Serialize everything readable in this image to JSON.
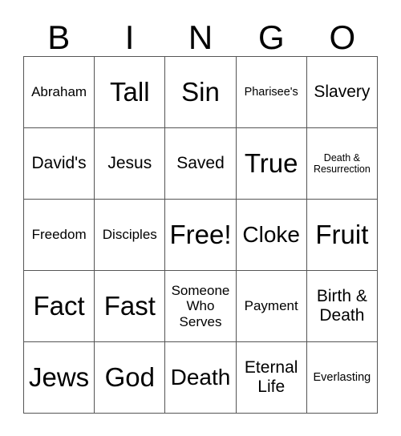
{
  "card": {
    "title": "BINGO",
    "header_letters": [
      "B",
      "I",
      "N",
      "G",
      "O"
    ],
    "columns": 5,
    "rows": 5,
    "border_color": "#555555",
    "text_color": "#000000",
    "background_color": "#ffffff",
    "cells": [
      {
        "row": 1,
        "col": 1,
        "column_letter": "B",
        "text": "Abraham",
        "size": "sm"
      },
      {
        "row": 1,
        "col": 2,
        "column_letter": "I",
        "text": "Tall",
        "size": "xl"
      },
      {
        "row": 1,
        "col": 3,
        "column_letter": "N",
        "text": "Sin",
        "size": "xl"
      },
      {
        "row": 1,
        "col": 4,
        "column_letter": "G",
        "text": "Pharisee's",
        "size": "xs"
      },
      {
        "row": 1,
        "col": 5,
        "column_letter": "O",
        "text": "Slavery",
        "size": "md"
      },
      {
        "row": 2,
        "col": 1,
        "column_letter": "B",
        "text": "David's",
        "size": "md"
      },
      {
        "row": 2,
        "col": 2,
        "column_letter": "I",
        "text": "Jesus",
        "size": "md"
      },
      {
        "row": 2,
        "col": 3,
        "column_letter": "N",
        "text": "Saved",
        "size": "md"
      },
      {
        "row": 2,
        "col": 4,
        "column_letter": "G",
        "text": "True",
        "size": "xl"
      },
      {
        "row": 2,
        "col": 5,
        "column_letter": "O",
        "text": "Death &\nResurrection",
        "size": "xxs"
      },
      {
        "row": 3,
        "col": 1,
        "column_letter": "B",
        "text": "Freedom",
        "size": "sm"
      },
      {
        "row": 3,
        "col": 2,
        "column_letter": "I",
        "text": "Disciples",
        "size": "sm"
      },
      {
        "row": 3,
        "col": 3,
        "column_letter": "N",
        "text": "Free!",
        "size": "xl"
      },
      {
        "row": 3,
        "col": 4,
        "column_letter": "G",
        "text": "Cloke",
        "size": "lg"
      },
      {
        "row": 3,
        "col": 5,
        "column_letter": "O",
        "text": "Fruit",
        "size": "xl"
      },
      {
        "row": 4,
        "col": 1,
        "column_letter": "B",
        "text": "Fact",
        "size": "xl"
      },
      {
        "row": 4,
        "col": 2,
        "column_letter": "I",
        "text": "Fast",
        "size": "xl"
      },
      {
        "row": 4,
        "col": 3,
        "column_letter": "N",
        "text": "Someone\nWho\nServes",
        "size": "sm"
      },
      {
        "row": 4,
        "col": 4,
        "column_letter": "G",
        "text": "Payment",
        "size": "sm"
      },
      {
        "row": 4,
        "col": 5,
        "column_letter": "O",
        "text": "Birth &\nDeath",
        "size": "md"
      },
      {
        "row": 5,
        "col": 1,
        "column_letter": "B",
        "text": "Jews",
        "size": "xl"
      },
      {
        "row": 5,
        "col": 2,
        "column_letter": "I",
        "text": "God",
        "size": "xl"
      },
      {
        "row": 5,
        "col": 3,
        "column_letter": "N",
        "text": "Death",
        "size": "lg"
      },
      {
        "row": 5,
        "col": 4,
        "column_letter": "G",
        "text": "Eternal\nLife",
        "size": "md"
      },
      {
        "row": 5,
        "col": 5,
        "column_letter": "O",
        "text": "Everlasting",
        "size": "xs"
      }
    ]
  }
}
